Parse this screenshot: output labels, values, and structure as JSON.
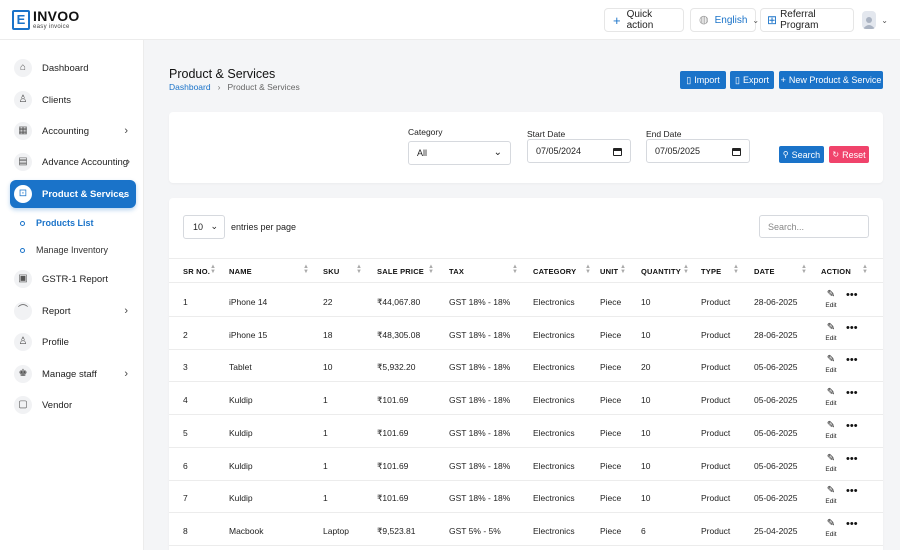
{
  "brand": {
    "name": "INVOO",
    "tagline": "easy invoice",
    "mark": "E"
  },
  "header": {
    "quick_action": "Quick action",
    "language": "English",
    "referral": "Referral Program"
  },
  "sidebar": {
    "items": [
      {
        "label": "Dashboard",
        "icon": "home-icon",
        "glyph": "⌂",
        "arrow": false
      },
      {
        "label": "Clients",
        "icon": "add-user-icon",
        "glyph": "♙",
        "arrow": false
      },
      {
        "label": "Accounting",
        "icon": "calculator-icon",
        "glyph": "▦",
        "arrow": true
      },
      {
        "label": "Advance Accounting",
        "icon": "bank-icon",
        "glyph": "▤",
        "arrow": true
      },
      {
        "label": "Product & Services",
        "icon": "cart-icon",
        "glyph": "⊡",
        "arrow": true,
        "active": true
      },
      {
        "label": "GSTR-1 Report",
        "icon": "report-icon",
        "glyph": "▣",
        "arrow": false
      },
      {
        "label": "Report",
        "icon": "chart-icon",
        "glyph": "⌒",
        "arrow": true
      },
      {
        "label": "Profile",
        "icon": "user-icon",
        "glyph": "♙",
        "arrow": false
      },
      {
        "label": "Manage staff",
        "icon": "users-icon",
        "glyph": "♚",
        "arrow": true
      },
      {
        "label": "Vendor",
        "icon": "note-icon",
        "glyph": "▢",
        "arrow": false
      }
    ],
    "sub_items": [
      {
        "label": "Products List",
        "active": true
      },
      {
        "label": "Manage Inventory",
        "active": false
      }
    ]
  },
  "page": {
    "title": "Product & Services",
    "breadcrumb": [
      "Dashboard",
      "Product & Services"
    ]
  },
  "actions": {
    "import": "Import",
    "export": "Export",
    "new": "New Product & Service"
  },
  "filters": {
    "category_label": "Category",
    "category_value": "All",
    "start_label": "Start Date",
    "start_value": "07/05/2024",
    "end_label": "End Date",
    "end_value": "07/05/2025",
    "search": "Search",
    "reset": "Reset"
  },
  "table": {
    "entries_value": "10",
    "entries_label": "entries per page",
    "search_placeholder": "Search...",
    "columns": [
      "SR NO.",
      "NAME",
      "SKU",
      "SALE PRICE",
      "TAX",
      "CATEGORY",
      "UNIT",
      "QUANTITY",
      "TYPE",
      "DATE",
      "ACTION"
    ],
    "edit_label": "Edit",
    "rows": [
      [
        "1",
        "iPhone 14",
        "22",
        "₹44,067.80",
        "GST 18% - 18%",
        "Electronics",
        "Piece",
        "10",
        "Product",
        "28-06-2025"
      ],
      [
        "2",
        "iPhone 15",
        "18",
        "₹48,305.08",
        "GST 18% - 18%",
        "Electronics",
        "Piece",
        "10",
        "Product",
        "28-06-2025"
      ],
      [
        "3",
        "Tablet",
        "10",
        "₹5,932.20",
        "GST 18% - 18%",
        "Electronics",
        "Piece",
        "20",
        "Product",
        "05-06-2025"
      ],
      [
        "4",
        "Kuldip",
        "1",
        "₹101.69",
        "GST 18% - 18%",
        "Electronics",
        "Piece",
        "10",
        "Product",
        "05-06-2025"
      ],
      [
        "5",
        "Kuldip",
        "1",
        "₹101.69",
        "GST 18% - 18%",
        "Electronics",
        "Piece",
        "10",
        "Product",
        "05-06-2025"
      ],
      [
        "6",
        "Kuldip",
        "1",
        "₹101.69",
        "GST 18% - 18%",
        "Electronics",
        "Piece",
        "10",
        "Product",
        "05-06-2025"
      ],
      [
        "7",
        "Kuldip",
        "1",
        "₹101.69",
        "GST 18% - 18%",
        "Electronics",
        "Piece",
        "10",
        "Product",
        "05-06-2025"
      ],
      [
        "8",
        "Macbook",
        "Laptop",
        "₹9,523.81",
        "GST 5% - 5%",
        "Electronics",
        "Piece",
        "6",
        "Product",
        "25-04-2025"
      ]
    ]
  },
  "colors": {
    "accent": "#1a73c9",
    "reset": "#f0436b"
  }
}
